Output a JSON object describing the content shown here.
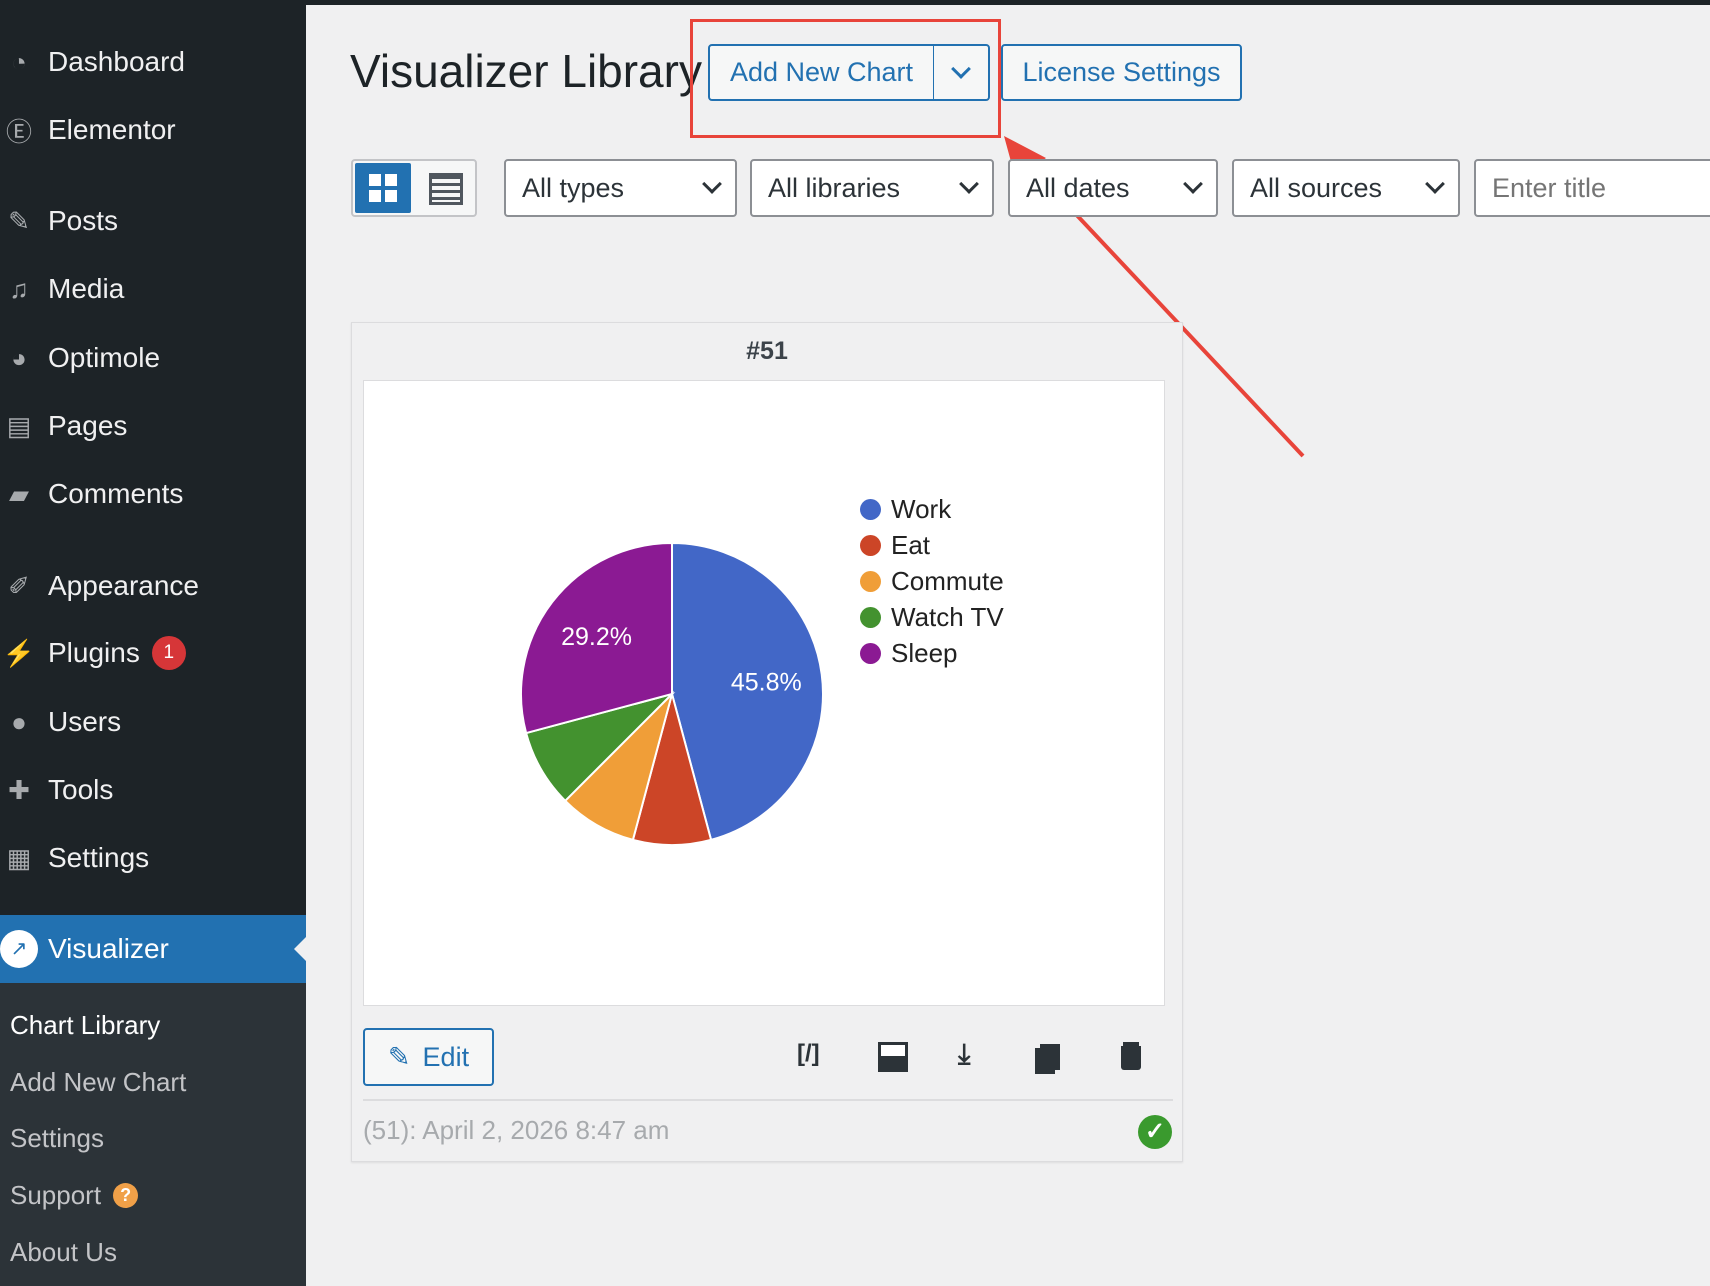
{
  "sidebar": {
    "items": [
      {
        "label": "Dashboard",
        "icon": "dashboard-icon"
      },
      {
        "label": "Elementor",
        "icon": "elementor-icon"
      },
      {
        "label": "Posts",
        "icon": "pin-icon"
      },
      {
        "label": "Media",
        "icon": "media-icon"
      },
      {
        "label": "Optimole",
        "icon": "optimole-icon"
      },
      {
        "label": "Pages",
        "icon": "pages-icon"
      },
      {
        "label": "Comments",
        "icon": "comment-icon"
      },
      {
        "label": "Appearance",
        "icon": "brush-icon"
      },
      {
        "label": "Plugins",
        "icon": "plugin-icon",
        "badge": "1"
      },
      {
        "label": "Users",
        "icon": "user-icon"
      },
      {
        "label": "Tools",
        "icon": "wrench-icon"
      },
      {
        "label": "Settings",
        "icon": "settings-icon"
      }
    ],
    "active": "Visualizer",
    "submenu": [
      "Chart Library",
      "Add New Chart",
      "Settings",
      "Support",
      "About Us"
    ],
    "support_badge": "?"
  },
  "header": {
    "title": "Visualizer Library",
    "add_new": "Add New Chart",
    "license": "License Settings"
  },
  "filters": {
    "types": "All types",
    "libraries": "All libraries",
    "dates": "All dates",
    "sources": "All sources",
    "title_placeholder": "Enter title"
  },
  "card": {
    "id": "#51",
    "edit": "Edit",
    "footer": "(51): April 2, 2026 8:47 am",
    "actions": {
      "shortcode": "[/]"
    }
  },
  "chart_data": {
    "type": "pie",
    "labels": [
      "Work",
      "Eat",
      "Commute",
      "Watch TV",
      "Sleep"
    ],
    "values": [
      11,
      2,
      2,
      2,
      7
    ],
    "colors": [
      "#4267c7",
      "#cc4527",
      "#f09e38",
      "#43922f",
      "#8b1a93"
    ],
    "slice_labels": [
      "45.8%",
      "",
      "",
      "",
      "29.2%"
    ],
    "legend": "right"
  }
}
